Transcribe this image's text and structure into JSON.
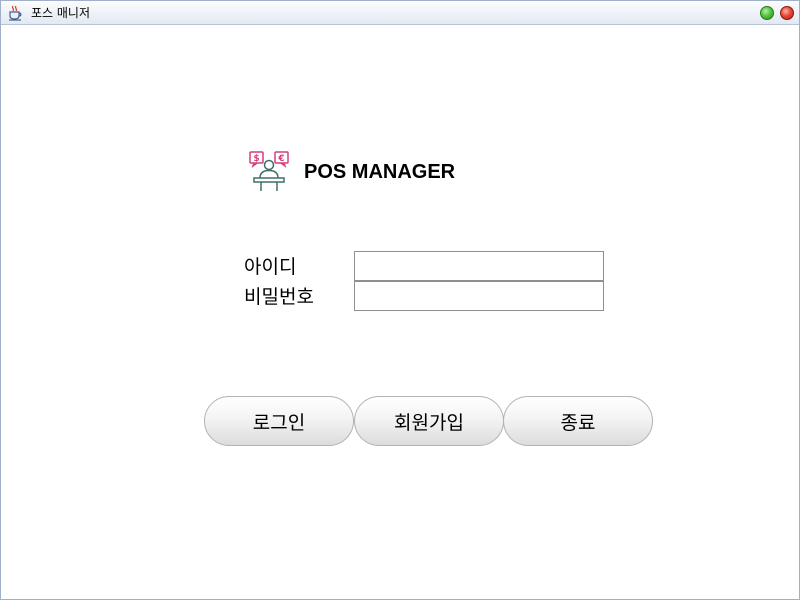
{
  "window": {
    "title": "포스 매니저"
  },
  "icons": {
    "title_icon": "java-cup-icon",
    "logo_icon": "cashier-icon",
    "minimize": "window-minimize-icon",
    "close": "window-close-icon"
  },
  "colors": {
    "logo_accent": "#d63f7c",
    "logo_line": "#3f6f6a"
  },
  "logo": {
    "app_name": "POS MANAGER"
  },
  "form": {
    "id_label": "아이디",
    "id_value": "",
    "password_label": "비밀번호",
    "password_value": ""
  },
  "buttons": {
    "login": "로그인",
    "signup": "회원가입",
    "exit": "종료"
  }
}
